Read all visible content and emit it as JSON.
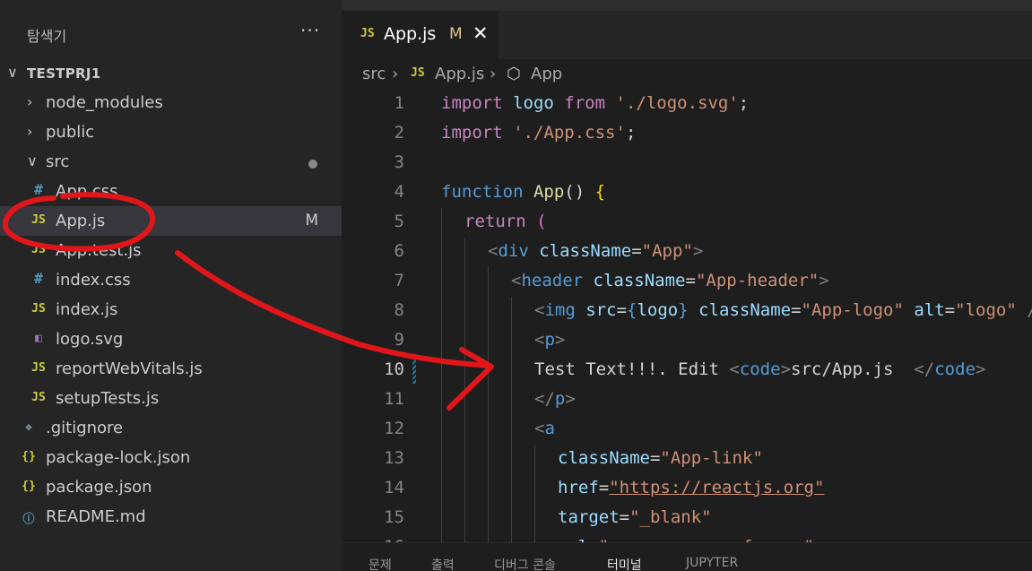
{
  "explorer": {
    "title": "탐색기",
    "more": "···",
    "root": "TESTPRJ1",
    "items": [
      {
        "label": "node_modules",
        "kind": "folder",
        "expanded": false,
        "depth": 1
      },
      {
        "label": "public",
        "kind": "folder",
        "expanded": false,
        "depth": 1
      },
      {
        "label": "src",
        "kind": "folder",
        "expanded": true,
        "depth": 1,
        "dot": true
      },
      {
        "label": "App.css",
        "kind": "css",
        "icon": "#",
        "depth": 2
      },
      {
        "label": "App.js",
        "kind": "js",
        "icon": "JS",
        "depth": 2,
        "badge": "M",
        "selected": true
      },
      {
        "label": "App.test.js",
        "kind": "js",
        "icon": "JS",
        "depth": 2
      },
      {
        "label": "index.css",
        "kind": "css",
        "icon": "#",
        "depth": 2
      },
      {
        "label": "index.js",
        "kind": "js",
        "icon": "JS",
        "depth": 2
      },
      {
        "label": "logo.svg",
        "kind": "svg",
        "icon": "◧",
        "depth": 2
      },
      {
        "label": "reportWebVitals.js",
        "kind": "js",
        "icon": "JS",
        "depth": 2
      },
      {
        "label": "setupTests.js",
        "kind": "js",
        "icon": "JS",
        "depth": 2
      },
      {
        "label": ".gitignore",
        "kind": "git",
        "icon": "◆",
        "depth": 1
      },
      {
        "label": "package-lock.json",
        "kind": "json",
        "icon": "{}",
        "depth": 1
      },
      {
        "label": "package.json",
        "kind": "json",
        "icon": "{}",
        "depth": 1
      },
      {
        "label": "README.md",
        "kind": "info",
        "icon": "ⓘ",
        "depth": 1
      }
    ]
  },
  "tab": {
    "icon": "JS",
    "label": "App.js",
    "modified": "M",
    "close": "✕"
  },
  "breadcrumb": {
    "folder": "src",
    "sep": "›",
    "file_icon": "JS",
    "file": "App.js",
    "symbol_icon": "⬡",
    "symbol": "App"
  },
  "code_lines": [
    {
      "n": "1",
      "indent": 0,
      "tokens": [
        [
          "import",
          "#c586c0"
        ],
        [
          " logo ",
          "#9cdcfe"
        ],
        [
          "from",
          "#c586c0"
        ],
        [
          " ",
          "#d4d4d4"
        ],
        [
          "'./logo.svg'",
          "#ce9178"
        ],
        [
          ";",
          "#d4d4d4"
        ]
      ]
    },
    {
      "n": "2",
      "indent": 0,
      "tokens": [
        [
          "import",
          "#c586c0"
        ],
        [
          " ",
          "#d4d4d4"
        ],
        [
          "'./App.css'",
          "#ce9178"
        ],
        [
          ";",
          "#d4d4d4"
        ]
      ]
    },
    {
      "n": "3",
      "indent": 0,
      "tokens": []
    },
    {
      "n": "4",
      "indent": 0,
      "tokens": [
        [
          "function",
          "#569cd6"
        ],
        [
          " ",
          "#d4d4d4"
        ],
        [
          "App",
          "#dcdcaa"
        ],
        [
          "() ",
          "#d4d4d4"
        ],
        [
          "{",
          "#ffd700"
        ]
      ]
    },
    {
      "n": "5",
      "indent": 1,
      "tokens": [
        [
          "return",
          "#c586c0"
        ],
        [
          " ",
          "#d4d4d4"
        ],
        [
          "(",
          "#da70d6"
        ]
      ]
    },
    {
      "n": "6",
      "indent": 2,
      "tokens": [
        [
          "<",
          "#808080"
        ],
        [
          "div",
          "#569cd6"
        ],
        [
          " ",
          "#d4d4d4"
        ],
        [
          "className",
          "#9cdcfe"
        ],
        [
          "=",
          "#d4d4d4"
        ],
        [
          "\"App\"",
          "#ce9178"
        ],
        [
          ">",
          "#808080"
        ]
      ]
    },
    {
      "n": "7",
      "indent": 3,
      "tokens": [
        [
          "<",
          "#808080"
        ],
        [
          "header",
          "#569cd6"
        ],
        [
          " ",
          "#d4d4d4"
        ],
        [
          "className",
          "#9cdcfe"
        ],
        [
          "=",
          "#d4d4d4"
        ],
        [
          "\"App-header\"",
          "#ce9178"
        ],
        [
          ">",
          "#808080"
        ]
      ]
    },
    {
      "n": "8",
      "indent": 4,
      "tokens": [
        [
          "<",
          "#808080"
        ],
        [
          "img",
          "#569cd6"
        ],
        [
          " ",
          "#d4d4d4"
        ],
        [
          "src",
          "#9cdcfe"
        ],
        [
          "=",
          "#d4d4d4"
        ],
        [
          "{",
          "#569cd6"
        ],
        [
          "logo",
          "#9cdcfe"
        ],
        [
          "}",
          "#569cd6"
        ],
        [
          " ",
          "#d4d4d4"
        ],
        [
          "className",
          "#9cdcfe"
        ],
        [
          "=",
          "#d4d4d4"
        ],
        [
          "\"App-logo\"",
          "#ce9178"
        ],
        [
          " ",
          "#d4d4d4"
        ],
        [
          "alt",
          "#9cdcfe"
        ],
        [
          "=",
          "#d4d4d4"
        ],
        [
          "\"logo\"",
          "#ce9178"
        ],
        [
          " />",
          "#808080"
        ]
      ]
    },
    {
      "n": "9",
      "indent": 4,
      "tokens": [
        [
          "<",
          "#808080"
        ],
        [
          "p",
          "#569cd6"
        ],
        [
          ">",
          "#808080"
        ]
      ]
    },
    {
      "n": "10",
      "indent": 4,
      "current": true,
      "modified": true,
      "tokens": [
        [
          "Test Text!!!. Edit ",
          "#d4d4d4"
        ],
        [
          "<",
          "#808080"
        ],
        [
          "code",
          "#569cd6"
        ],
        [
          ">",
          "#808080"
        ],
        [
          "src/App.js",
          "#d4d4d4"
        ],
        [
          "  ",
          "#d4d4d4"
        ],
        [
          "</",
          "#808080"
        ],
        [
          "code",
          "#569cd6"
        ],
        [
          ">",
          "#808080"
        ]
      ]
    },
    {
      "n": "11",
      "indent": 4,
      "tokens": [
        [
          "</",
          "#808080"
        ],
        [
          "p",
          "#569cd6"
        ],
        [
          ">",
          "#808080"
        ]
      ]
    },
    {
      "n": "12",
      "indent": 4,
      "tokens": [
        [
          "<",
          "#808080"
        ],
        [
          "a",
          "#569cd6"
        ]
      ]
    },
    {
      "n": "13",
      "indent": 5,
      "tokens": [
        [
          "className",
          "#9cdcfe"
        ],
        [
          "=",
          "#d4d4d4"
        ],
        [
          "\"App-link\"",
          "#ce9178"
        ]
      ]
    },
    {
      "n": "14",
      "indent": 5,
      "tokens": [
        [
          "href",
          "#9cdcfe"
        ],
        [
          "=",
          "#d4d4d4"
        ],
        [
          "\"https://reactjs.org\"",
          "#ce9178",
          "link"
        ]
      ]
    },
    {
      "n": "15",
      "indent": 5,
      "tokens": [
        [
          "target",
          "#9cdcfe"
        ],
        [
          "=",
          "#d4d4d4"
        ],
        [
          "\"_blank\"",
          "#ce9178"
        ]
      ]
    },
    {
      "n": "16",
      "indent": 5,
      "tokens": [
        [
          "rel",
          "#9cdcfe"
        ],
        [
          "=",
          "#d4d4d4"
        ],
        [
          "\"noopener noreferrer\"",
          "#ce9178"
        ]
      ]
    }
  ],
  "panel_tabs": [
    {
      "label": "문제",
      "active": false
    },
    {
      "label": "출력",
      "active": false
    },
    {
      "label": "디버그 콘솔",
      "active": false
    },
    {
      "label": "터미널",
      "active": true
    },
    {
      "label": "JUPYTER",
      "active": false
    }
  ],
  "colors": {
    "annotation": "#e0161b",
    "accent": "#1b81a8",
    "js_icon": "#cbcb41",
    "css_icon": "#519aba"
  }
}
